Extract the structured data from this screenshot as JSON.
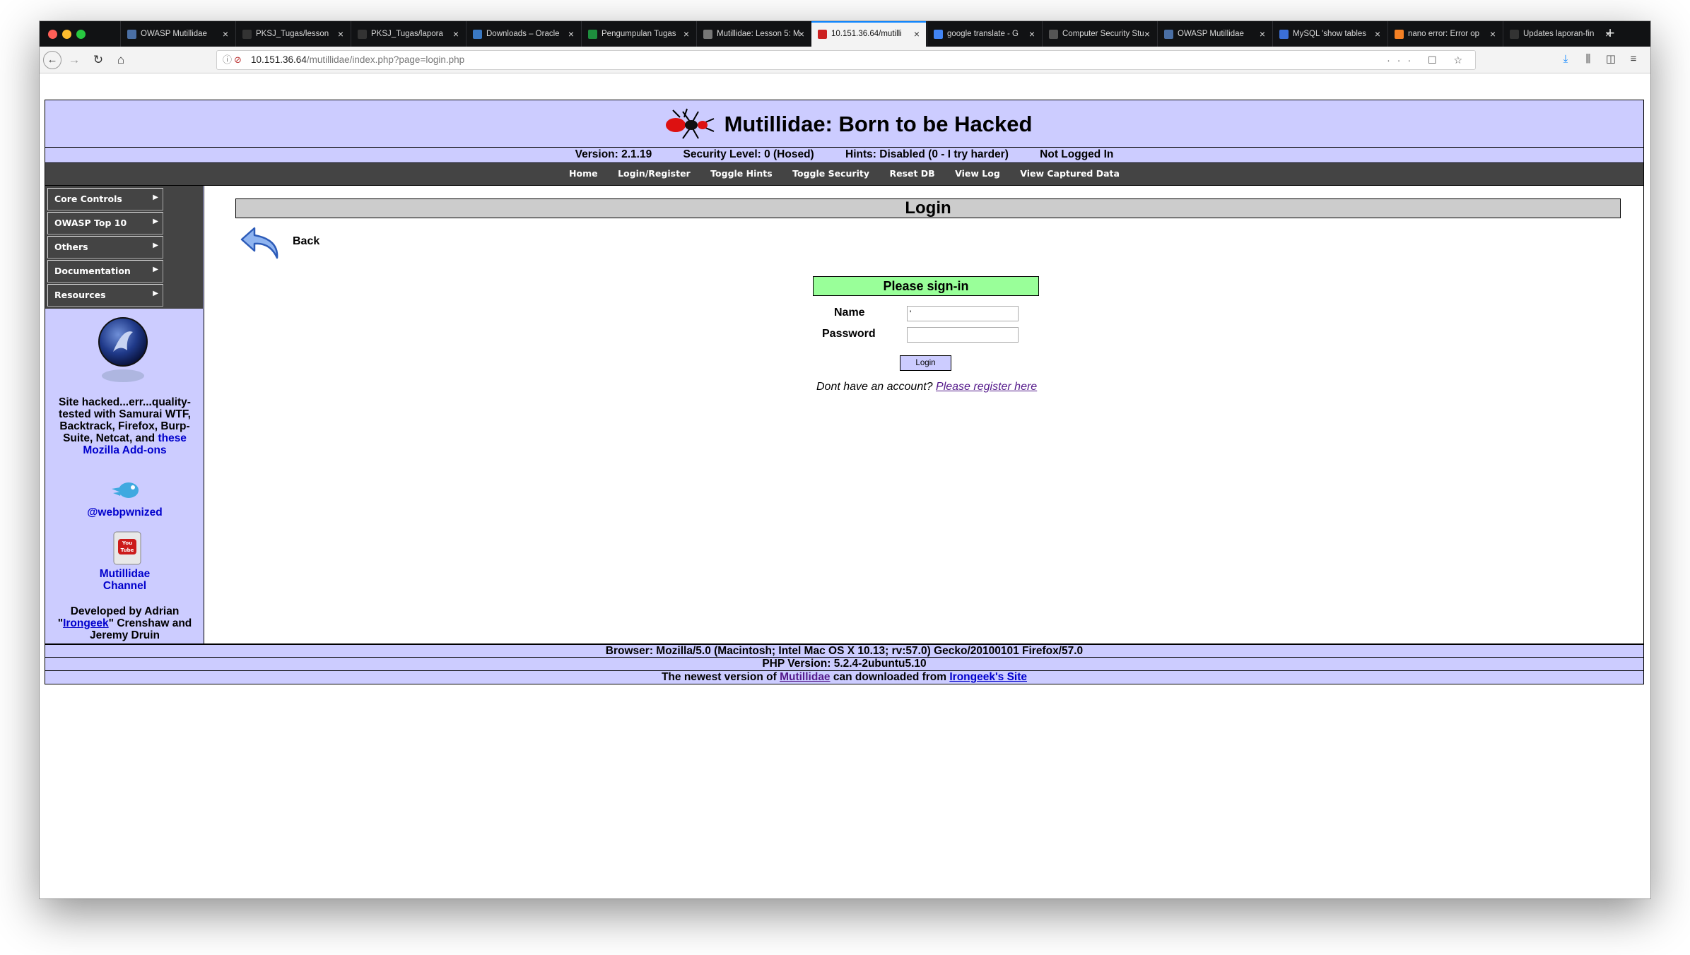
{
  "browser": {
    "tabs": [
      {
        "label": "OWASP Mutillidae",
        "favicon_color": "#4a6fa5"
      },
      {
        "label": "PKSJ_Tugas/lesson",
        "favicon_color": "#333333"
      },
      {
        "label": "PKSJ_Tugas/lapora",
        "favicon_color": "#333333"
      },
      {
        "label": "Downloads – Oracle",
        "favicon_color": "#3a78c2"
      },
      {
        "label": "Pengumpulan Tugas",
        "favicon_color": "#1e8e3e"
      },
      {
        "label": "Mutillidae: Lesson 5: M",
        "favicon_color": "#777777"
      },
      {
        "label": "10.151.36.64/mutilli",
        "favicon_color": "#cc2222"
      },
      {
        "label": "google translate - G",
        "favicon_color": "#4285f4"
      },
      {
        "label": "Computer Security Stu",
        "favicon_color": "#555555"
      },
      {
        "label": "OWASP Mutillidae",
        "favicon_color": "#4a6fa5"
      },
      {
        "label": "MySQL 'show tables",
        "favicon_color": "#3b6fd6"
      },
      {
        "label": "nano error: Error op",
        "favicon_color": "#f48024"
      },
      {
        "label": "Updates laporan-fin",
        "favicon_color": "#333333"
      }
    ],
    "active_tab": 6,
    "url_host": "10.151.36.64",
    "url_path": "/mutillidae/index.php?page=login.php",
    "url_actions": "··· ☐ ☆"
  },
  "site": {
    "title": "Mutillidae: Born to be Hacked",
    "status": {
      "version": "Version: 2.1.19",
      "security": "Security Level: 0 (Hosed)",
      "hints": "Hints: Disabled (0 - I try harder)",
      "login": "Not Logged In"
    },
    "menu": [
      "Home",
      "Login/Register",
      "Toggle Hints",
      "Toggle Security",
      "Reset DB",
      "View Log",
      "View Captured Data"
    ]
  },
  "sidebar": {
    "items": [
      "Core Controls",
      "OWASP Top 10",
      "Others",
      "Documentation",
      "Resources"
    ],
    "blurb_pre": "Site hacked...err...quality-tested with Samurai WTF, Backtrack, Firefox, Burp-Suite, Netcat, and ",
    "blurb_link": "these Mozilla Add-ons",
    "twitter": "@webpwnized",
    "channel_1": "Mutillidae",
    "channel_2": "Channel",
    "dev_pre": "Developed by Adrian \"",
    "dev_link": "Irongeek",
    "dev_post": "\" Crenshaw and Jeremy Druin"
  },
  "login": {
    "heading": "Login",
    "back": "Back",
    "signin": "Please sign-in",
    "name_label": "Name",
    "name_value": "'",
    "password_label": "Password",
    "password_value": "",
    "submit": "Login",
    "register_text": "Dont have an account? ",
    "register_link": "Please register here"
  },
  "footer": {
    "browser": "Browser: Mozilla/5.0 (Macintosh; Intel Mac OS X 10.13; rv:57.0) Gecko/20100101 Firefox/57.0",
    "php": "PHP Version: 5.2.4-2ubuntu5.10",
    "newest_pre": "The newest version of ",
    "newest_link1": "Mutillidae",
    "newest_mid": " can downloaded from ",
    "newest_link2": "Irongeek's Site"
  }
}
